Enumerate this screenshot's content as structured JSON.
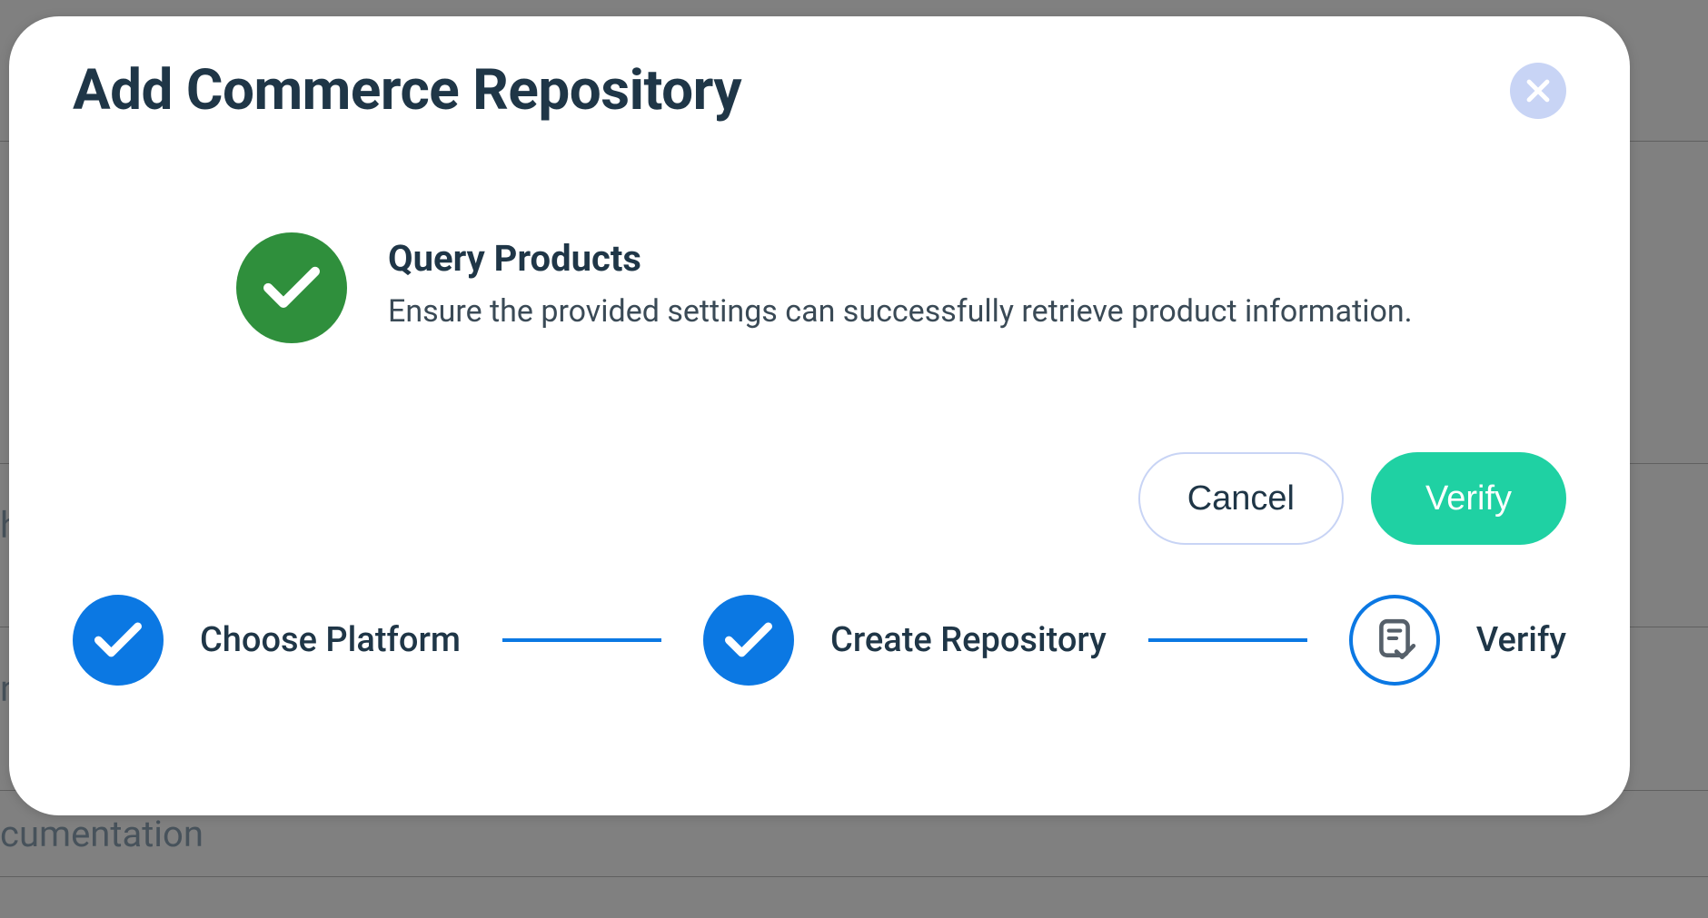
{
  "modal": {
    "title": "Add Commerce Repository",
    "status": {
      "heading": "Query Products",
      "description": "Ensure the provided settings can successfully retrieve product information."
    },
    "buttons": {
      "cancel": "Cancel",
      "verify": "Verify"
    }
  },
  "stepper": {
    "steps": [
      {
        "label": "Choose Platform",
        "state": "done"
      },
      {
        "label": "Create Repository",
        "state": "done"
      },
      {
        "label": "Verify",
        "state": "current"
      }
    ]
  },
  "backdrop": {
    "text1": "h",
    "text2": "n",
    "text3": "cumentation"
  }
}
